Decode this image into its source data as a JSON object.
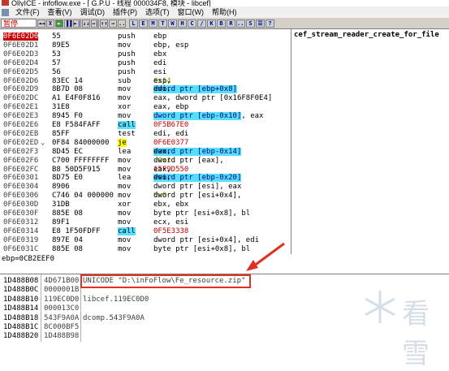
{
  "window": {
    "title": "OllyICE - infoflow.exe - [ G.P.U - 线程 000034F8, 模块 - libcef]"
  },
  "menu": [
    "文件(F)",
    "查看(V)",
    "调试(D)",
    "插件(P)",
    "选项(T)",
    "窗口(W)",
    "帮助(H)"
  ],
  "toolbar": {
    "status": "暂停",
    "buttons": [
      "◄◄",
      "X",
      "►",
      "▐▐",
      "►|",
      "↓↓",
      "→|",
      "↑↑",
      "→",
      "...",
      "L",
      "E",
      "M",
      "T",
      "W",
      "H",
      "C",
      "/",
      "K",
      "B",
      "R",
      "...",
      "S",
      "☰",
      "?"
    ]
  },
  "disasm": {
    "comment_header": "cef_stream_reader_create_for_file",
    "rows": [
      {
        "addr": "0F6E02D0",
        "bytes": "55",
        "mn": "push",
        "ops": [
          {
            "t": "ebp"
          }
        ],
        "sel": true
      },
      {
        "addr": "0F6E02D1",
        "bytes": "89E5",
        "mn": "mov",
        "ops": [
          {
            "t": "ebp, esp"
          }
        ]
      },
      {
        "addr": "0F6E02D3",
        "bytes": "53",
        "mn": "push",
        "ops": [
          {
            "t": "ebx"
          }
        ]
      },
      {
        "addr": "0F6E02D4",
        "bytes": "57",
        "mn": "push",
        "ops": [
          {
            "t": "edi"
          }
        ]
      },
      {
        "addr": "0F6E02D5",
        "bytes": "56",
        "mn": "push",
        "ops": [
          {
            "t": "esi"
          }
        ]
      },
      {
        "addr": "0F6E02D6",
        "bytes": "83EC 14",
        "mn": "sub",
        "ops": [
          {
            "t": "esp, "
          },
          {
            "t": "0x14",
            "c": "num"
          }
        ]
      },
      {
        "addr": "0F6E02D9",
        "bytes": "8B7D 08",
        "mn": "mov",
        "ops": [
          {
            "t": "edi, "
          },
          {
            "t": "dword ptr [ebp+0x8]",
            "c": "kw"
          }
        ]
      },
      {
        "addr": "0F6E02DC",
        "bytes": "A1 E4F0F816",
        "mn": "mov",
        "ops": [
          {
            "t": "eax, dword ptr [0x16F8F0E4]"
          }
        ]
      },
      {
        "addr": "0F6E02E1",
        "bytes": "31E8",
        "mn": "xor",
        "ops": [
          {
            "t": "eax, ebp"
          }
        ]
      },
      {
        "addr": "0F6E02E3",
        "bytes": "8945 F0",
        "mn": "mov",
        "ops": [
          {
            "t": "dword ptr [ebp-0x10]",
            "c": "kw"
          },
          {
            "t": ", eax"
          }
        ]
      },
      {
        "addr": "0F6E02E6",
        "bytes": "E8 F584FAFF",
        "mn": "call",
        "mnc": "hl-call",
        "ops": [
          {
            "t": "0F5B67E0",
            "c": "tgt"
          }
        ]
      },
      {
        "addr": "0F6E02EB",
        "bytes": "85FF",
        "mn": "test",
        "ops": [
          {
            "t": "edi, edi"
          }
        ]
      },
      {
        "addr": "0F6E02ED",
        "bytes": "0F84 84000000",
        "mn": "je",
        "mnc": "hl-je",
        "arrow": "⌄",
        "ops": [
          {
            "t": "0F6E0377",
            "c": "tgt"
          }
        ]
      },
      {
        "addr": "0F6E02F3",
        "bytes": "8D45 EC",
        "mn": "lea",
        "ops": [
          {
            "t": "eax, "
          },
          {
            "t": "dword ptr [ebp-0x14]",
            "c": "kw"
          }
        ]
      },
      {
        "addr": "0F6E02F6",
        "bytes": "C700 FFFFFFFF",
        "mn": "mov",
        "ops": [
          {
            "t": "dword ptr [eax], "
          },
          {
            "t": "-0x1",
            "c": "num"
          }
        ]
      },
      {
        "addr": "0F6E02FC",
        "bytes": "B8 50D5F915",
        "mn": "mov",
        "ops": [
          {
            "t": "eax, "
          },
          {
            "t": "15F9D550",
            "c": "tgt"
          }
        ]
      },
      {
        "addr": "0F6E0301",
        "bytes": "8D75 E0",
        "mn": "lea",
        "ops": [
          {
            "t": "esi, "
          },
          {
            "t": "dword ptr [ebp-0x20]",
            "c": "kw"
          }
        ]
      },
      {
        "addr": "0F6E0304",
        "bytes": "8906",
        "mn": "mov",
        "ops": [
          {
            "t": "dword ptr [esi], eax"
          }
        ]
      },
      {
        "addr": "0F6E0306",
        "bytes": "C746 04 000000",
        "mn": "mov",
        "ops": [
          {
            "t": "dword ptr [esi+0x4], "
          },
          {
            "t": "0x0",
            "c": "num"
          }
        ]
      },
      {
        "addr": "0F6E030D",
        "bytes": "31DB",
        "mn": "xor",
        "ops": [
          {
            "t": "ebx, ebx"
          }
        ]
      },
      {
        "addr": "0F6E030F",
        "bytes": "885E 08",
        "mn": "mov",
        "ops": [
          {
            "t": "byte ptr [esi+0x8], bl"
          }
        ]
      },
      {
        "addr": "0F6E0312",
        "bytes": "89F1",
        "mn": "mov",
        "ops": [
          {
            "t": "ecx, esi"
          }
        ]
      },
      {
        "addr": "0F6E0314",
        "bytes": "E8 1F50FDFF",
        "mn": "call",
        "mnc": "hl-call",
        "ops": [
          {
            "t": "0F5E3338",
            "c": "tgt"
          }
        ]
      },
      {
        "addr": "0F6E0319",
        "bytes": "897E 04",
        "mn": "mov",
        "ops": [
          {
            "t": "dword ptr [esi+0x4], edi"
          }
        ]
      },
      {
        "addr": "0F6E031C",
        "bytes": "885E 08",
        "mn": "mov",
        "ops": [
          {
            "t": "byte ptr [esi+0x8], bl"
          }
        ]
      }
    ]
  },
  "info": {
    "text": "ebp=0CB2EEF0"
  },
  "dump": [
    {
      "addr": "1D488B08",
      "val": "4D671B00",
      "cmt": "UNICODE \"D:\\inFoFlow\\Fe_resource.zip\""
    },
    {
      "addr": "1D488B0C",
      "val": "0000001B",
      "cmt": ""
    },
    {
      "addr": "1D488B10",
      "val": "119EC0D0",
      "cmt": "libcef.119EC0D0"
    },
    {
      "addr": "1D488B14",
      "val": "000013C0",
      "cmt": ""
    },
    {
      "addr": "1D488B18",
      "val": "543F9A0A",
      "cmt": "dcomp.543F9A0A"
    },
    {
      "addr": "1D488B1C",
      "val": "8C000BF5",
      "cmt": ""
    },
    {
      "addr": "1D488B20",
      "val": "1D488B98",
      "cmt": ""
    }
  ],
  "watermark": {
    "text": "看雪"
  },
  "colors": {
    "selected_addr_bg": "#cc0000",
    "call_highlight": "#55e0ff",
    "je_highlight": "#ffff00",
    "annotation_red": "#e03020"
  }
}
